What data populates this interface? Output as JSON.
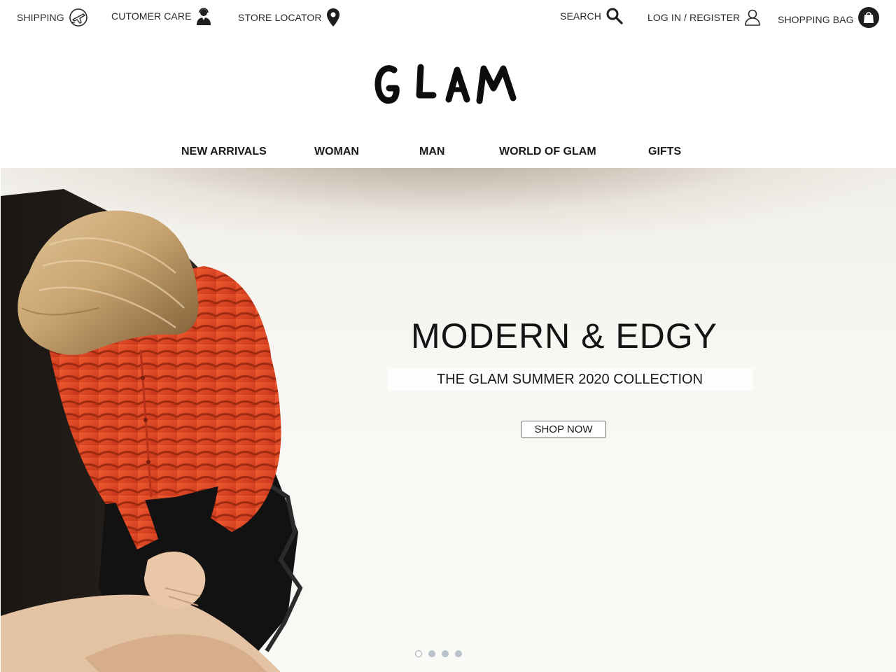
{
  "utility": {
    "shipping": "SHIPPING",
    "customer_care": "CUTOMER CARE",
    "store_locator": "STORE LOCATOR",
    "search": "SEARCH",
    "login_register": "LOG IN / REGISTER",
    "shopping_bag": "SHOPPING BAG"
  },
  "brand": {
    "logo_text": "GLAM"
  },
  "nav": {
    "items": [
      "NEW ARRIVALS",
      "WOMAN",
      "MAN",
      "WORLD OF GLAM",
      "GIFTS"
    ]
  },
  "hero": {
    "title": "MODERN & EDGY",
    "subtitle": "THE GLAM SUMMER 2020 COLLECTION",
    "cta": "SHOP NOW",
    "slides_total": 4,
    "active_slide": 1
  },
  "icons": {
    "shipping": "airplane-stamp-icon",
    "customer_care": "person-headset-icon",
    "store_locator": "map-pin-icon",
    "search": "magnifier-icon",
    "login": "user-outline-icon",
    "bag": "shopping-bag-icon"
  },
  "colors": {
    "text": "#1b1b1b",
    "sweater": "#e2441f",
    "hair": "#c9a571",
    "background": "#f9f9f6",
    "dot_active": "#b9c2cc"
  }
}
